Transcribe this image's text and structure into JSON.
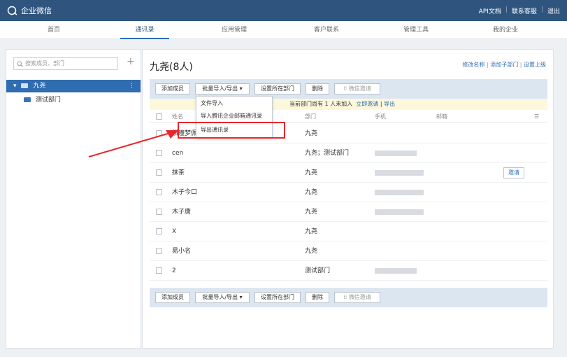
{
  "app": {
    "brand": "企业微信"
  },
  "top_links": [
    "API文档",
    "联系客服",
    "退出"
  ],
  "nav": [
    "首页",
    "通讯录",
    "应用管理",
    "客户联系",
    "管理工具",
    "我的企业"
  ],
  "left": {
    "search_placeholder": "搜索成员、部门",
    "add": "+",
    "root": "九尧",
    "root_more": "⋮",
    "child": "测试部门"
  },
  "main": {
    "title": "九尧(8人)",
    "links": [
      "修改名称",
      "添加子部门",
      "设置上级"
    ],
    "toolbar": {
      "add_member": "添加成员",
      "batch": "批量导入/导出 ▾",
      "set_dept": "设置所在部门",
      "delete": "删除",
      "wechat_invite": "微信邀请"
    },
    "notice": {
      "text": "当前部门尚有 1 人未加入",
      "invite": "立即邀请",
      "export": "导出"
    },
    "headers": {
      "name": "姓名",
      "dept": "部门",
      "phone": "手机",
      "email": "邮箱",
      "menu": "☰"
    },
    "rows": [
      {
        "name": "棋瞳梦佩",
        "dept": "九尧"
      },
      {
        "name": "cen",
        "dept": "九尧；测试部门"
      },
      {
        "name": "抹茶",
        "dept": "九尧"
      },
      {
        "name": "木子今口",
        "dept": "九尧"
      },
      {
        "name": "木子唐",
        "dept": "九尧"
      },
      {
        "name": "X",
        "dept": "九尧"
      },
      {
        "name": "易小名",
        "dept": "九尧"
      },
      {
        "name": "2",
        "dept": "测试部门"
      }
    ],
    "invite_btn": "邀请",
    "dropdown": [
      "文件导入",
      "导入腾讯企业邮箱通讯录",
      "导出通讯录"
    ]
  },
  "colors": {
    "topbar": "#2f557e",
    "accent": "#2f6cb0",
    "highlight": "#e8262b",
    "folder": "#3b74b5"
  }
}
